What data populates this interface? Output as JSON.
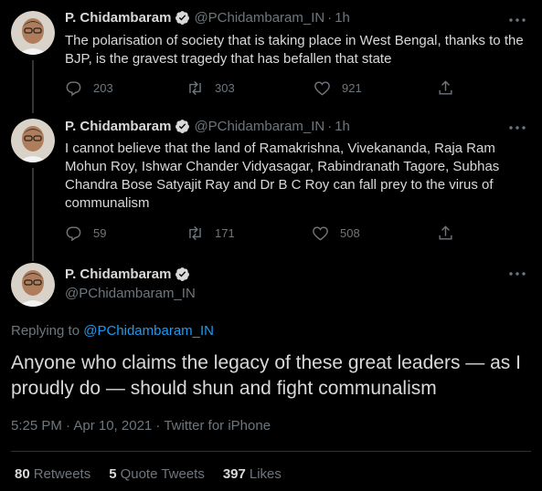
{
  "author": {
    "name": "P. Chidambaram",
    "handle": "@PChidambaram_IN"
  },
  "tweets": [
    {
      "time": "1h",
      "text": "The polarisation of society that is taking place in West Bengal, thanks to the BJP, is the gravest tragedy that has befallen that state",
      "replies": "203",
      "retweets": "303",
      "likes": "921"
    },
    {
      "time": "1h",
      "text": "I cannot believe that the land of Ramakrishna, Vivekananda, Raja Ram Mohun Roy, Ishwar Chander Vidyasagar, Rabindranath Tagore, Subhas Chandra Bose Satyajit Ray and Dr B C Roy can fall prey to the virus of communalism",
      "replies": "59",
      "retweets": "171",
      "likes": "508"
    }
  ],
  "main_tweet": {
    "replying_label": "Replying to",
    "replying_to": "@PChidambaram_IN",
    "text": "Anyone who claims the legacy of these great leaders — as I proudly do — should shun and fight communalism",
    "meta": "5:25 PM · Apr 10, 2021 · Twitter for iPhone",
    "retweets_count": "80",
    "retweets_label": "Retweets",
    "quotes_count": "5",
    "quotes_label": "Quote Tweets",
    "likes_count": "397",
    "likes_label": "Likes"
  },
  "separator": "·",
  "icons": {
    "verified": "verified-badge-icon",
    "reply": "reply-icon",
    "retweet": "retweet-icon",
    "like": "heart-icon",
    "share": "share-icon",
    "more": "more-icon"
  },
  "colors": {
    "background": "#000000",
    "text": "#d9d9d9",
    "muted": "#6e767d",
    "accent": "#1d9bf0"
  }
}
